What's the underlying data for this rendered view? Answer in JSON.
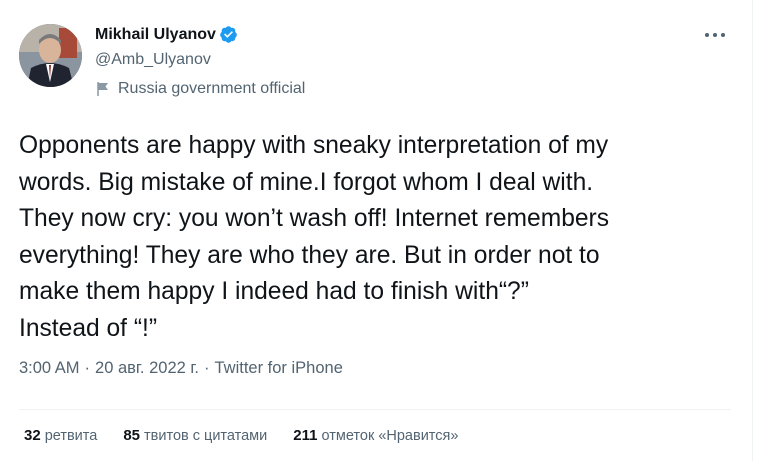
{
  "author": {
    "name": "Mikhail Ulyanov",
    "handle": "@Amb_Ulyanov",
    "label": "Russia government official",
    "verified_color": "#1d9bf0"
  },
  "tweet": {
    "text": "Opponents are happy with sneaky  interpretation of my\nwords. Big mistake of mine.I forgot whom I deal with.\nThey now cry: you won’t wash off! Internet remembers\neverything! They are who they are. But in order not to\nmake them happy I indeed had to finish with“?”\nInstead of “!”"
  },
  "meta": {
    "time": "3:00 AM",
    "separator": "·",
    "date": "20 авг. 2022 г.",
    "source": "Twitter for iPhone"
  },
  "stats": {
    "retweets": {
      "count": "32",
      "label": "ретвита"
    },
    "quotes": {
      "count": "85",
      "label": "твитов с цитатами"
    },
    "likes": {
      "count": "211",
      "label": "отметок «Нравится»"
    }
  },
  "icons": {
    "more": "more-horizontal-icon",
    "verified": "verified-badge-icon",
    "label": "flag-icon"
  }
}
